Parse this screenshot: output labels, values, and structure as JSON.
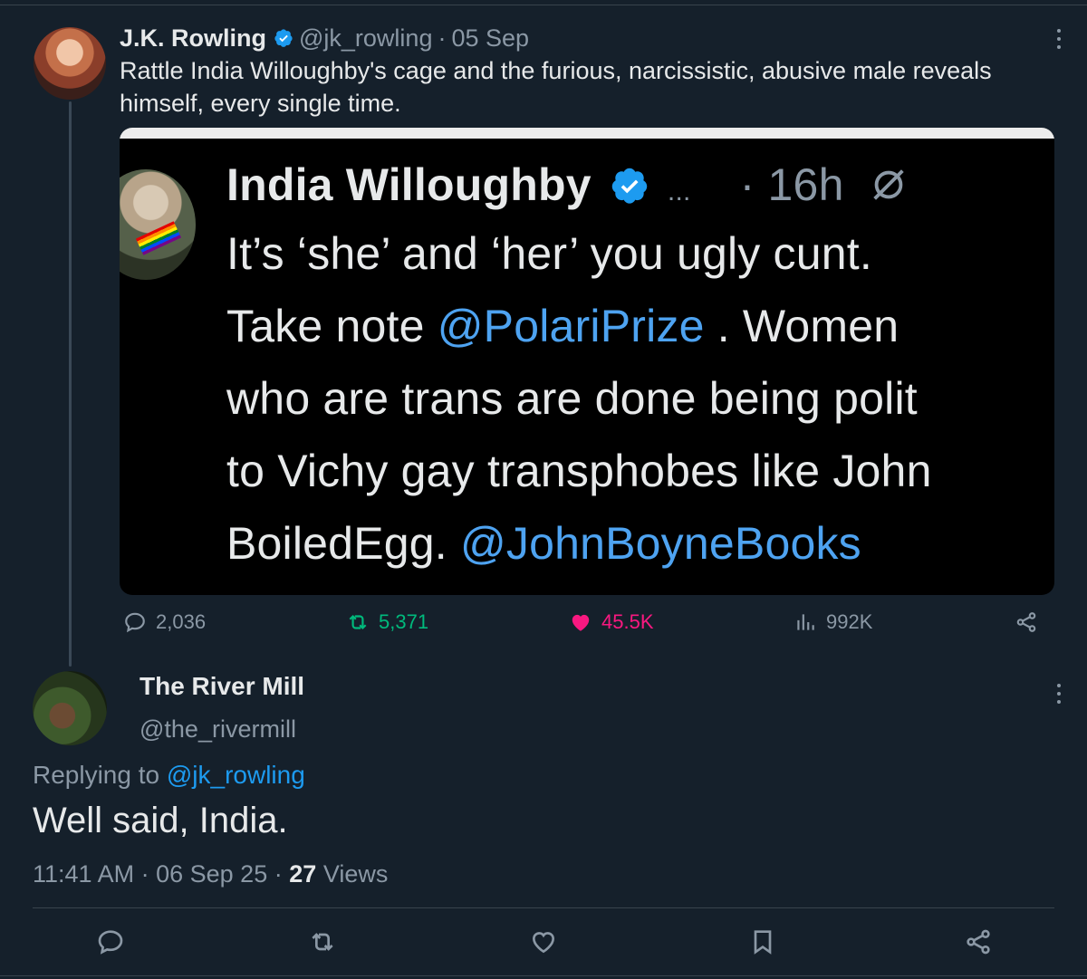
{
  "colors": {
    "background": "#15202b",
    "text": "#e7e9ea",
    "muted": "#8b98a5",
    "link": "#1d9bf0",
    "retweet": "#00ba7c",
    "like": "#f91880"
  },
  "original_tweet": {
    "author_name": "J.K. Rowling",
    "verified": true,
    "handle": "@jk_rowling",
    "separator": "·",
    "date": "05 Sep",
    "text": "Rattle India Willoughby's cage and the furious, narcissistic, abusive male reveals himself, every single time.",
    "embedded_image": {
      "author_name": "India Willoughby",
      "ellipsis": "...",
      "time": "· 16h",
      "line1": "It’s ‘she’ and ‘her’ you ugly cunt.",
      "line2_pre": "Take note ",
      "line2_link": "@PolariPrize",
      "line2_post": " . Women",
      "line3": "who are trans are done being polit",
      "line4": "to Vichy gay transphobes like John",
      "line5_pre": "BoiledEgg. ",
      "line5_link": "@JohnBoyneBooks"
    },
    "stats": {
      "replies": "2,036",
      "retweets": "5,371",
      "likes": "45.5K",
      "views": "992K"
    },
    "icons": [
      "reply-icon",
      "retweet-icon",
      "heart-icon",
      "views-icon",
      "share-icon",
      "more-icon",
      "verified-icon"
    ]
  },
  "reply_tweet": {
    "author_name": "The River Mill",
    "handle": "@the_rivermill",
    "replying_to_label": "Replying to ",
    "replying_to_handle": "@jk_rowling",
    "text": "Well said, India.",
    "time": "11:41 AM",
    "date": "06 Sep 25",
    "views_count": "27",
    "views_label": "Views",
    "icons": [
      "reply-icon",
      "retweet-icon",
      "heart-icon",
      "bookmark-icon",
      "share-icon",
      "more-icon"
    ]
  }
}
